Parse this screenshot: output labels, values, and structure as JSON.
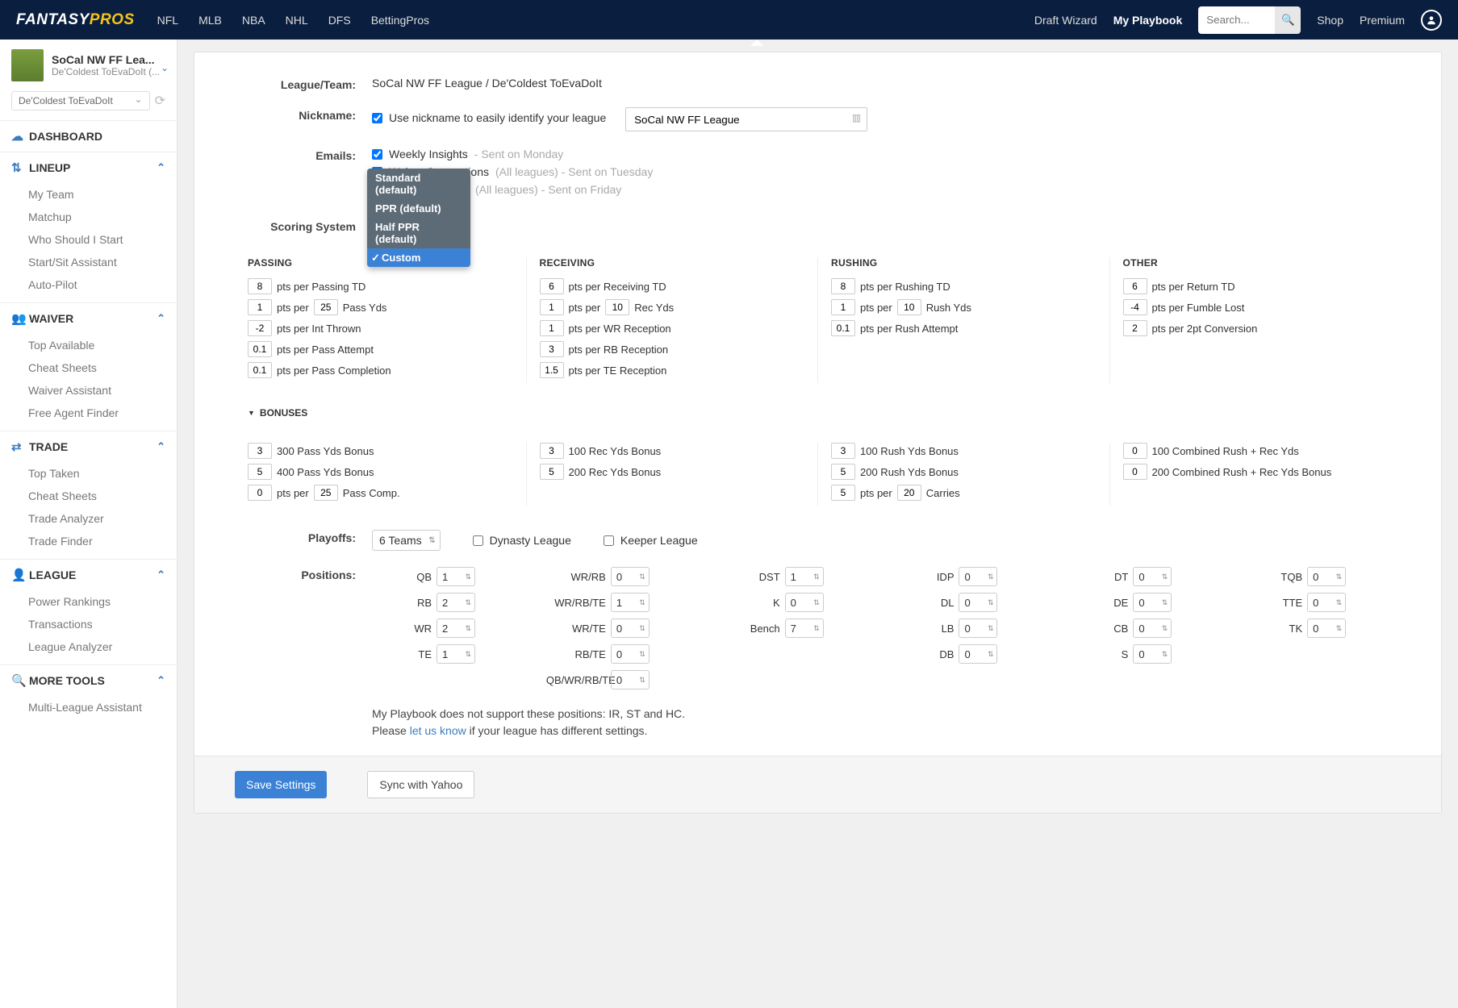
{
  "header": {
    "nav": [
      "NFL",
      "MLB",
      "NBA",
      "NHL",
      "DFS",
      "BettingPros"
    ],
    "draft_wizard": "Draft Wizard",
    "my_playbook": "My Playbook",
    "search_placeholder": "Search...",
    "shop": "Shop",
    "premium": "Premium"
  },
  "sidebar": {
    "team_name": "SoCal NW FF Lea...",
    "team_owner": "De'Coldest ToEvaDoIt (...",
    "team_select": "De'Coldest ToEvaDoIt",
    "sections": {
      "dashboard": "DASHBOARD",
      "lineup": {
        "label": "LINEUP",
        "items": [
          "My Team",
          "Matchup",
          "Who Should I Start",
          "Start/Sit Assistant",
          "Auto-Pilot"
        ]
      },
      "waiver": {
        "label": "WAIVER",
        "items": [
          "Top Available",
          "Cheat Sheets",
          "Waiver Assistant",
          "Free Agent Finder"
        ]
      },
      "trade": {
        "label": "TRADE",
        "items": [
          "Top Taken",
          "Cheat Sheets",
          "Trade Analyzer",
          "Trade Finder"
        ]
      },
      "league": {
        "label": "LEAGUE",
        "items": [
          "Power Rankings",
          "Transactions",
          "League Analyzer"
        ]
      },
      "more": {
        "label": "MORE TOOLS",
        "items": [
          "Multi-League Assistant"
        ]
      }
    }
  },
  "form": {
    "league_team_label": "League/Team:",
    "league_team_value": "SoCal NW FF League / De'Coldest ToEvaDoIt",
    "nickname_label": "Nickname:",
    "nickname_chk": "Use nickname to easily identify your league",
    "nickname_value": "SoCal NW FF League",
    "emails_label": "Emails:",
    "emails": [
      {
        "label": "Weekly Insights",
        "sub": "- Sent on Monday"
      },
      {
        "label": "Waiver Suggestions",
        "sub": "(All leagues) - Sent on Tuesday"
      },
      {
        "label": "",
        "sub": "(All leagues) - Sent on Friday"
      }
    ],
    "scoring_label": "Scoring System",
    "scoring_options": [
      "Standard (default)",
      "PPR (default)",
      "Half PPR (default)",
      "Custom"
    ],
    "playoffs_label": "Playoffs:",
    "playoffs_value": "6 Teams",
    "dynasty": "Dynasty League",
    "keeper": "Keeper League",
    "positions_label": "Positions:",
    "note1": "My Playbook does not support these positions: IR, ST and HC.",
    "note2a": "Please ",
    "note2b": "let us know",
    "note2c": " if your league has different settings.",
    "save": "Save Settings",
    "sync": "Sync with Yahoo"
  },
  "scoring": {
    "passing": {
      "title": "PASSING",
      "rows": [
        {
          "v": "8",
          "t": "pts per Passing TD"
        },
        {
          "v": "1",
          "t": "pts per",
          "v2": "25",
          "t2": "Pass Yds"
        },
        {
          "v": "-2",
          "t": "pts per Int Thrown"
        },
        {
          "v": "0.1",
          "t": "pts per Pass Attempt"
        },
        {
          "v": "0.1",
          "t": "pts per Pass Completion"
        }
      ]
    },
    "receiving": {
      "title": "RECEIVING",
      "rows": [
        {
          "v": "6",
          "t": "pts per Receiving TD"
        },
        {
          "v": "1",
          "t": "pts per",
          "v2": "10",
          "t2": "Rec Yds"
        },
        {
          "v": "1",
          "t": "pts per WR Reception"
        },
        {
          "v": "3",
          "t": "pts per RB Reception"
        },
        {
          "v": "1.5",
          "t": "pts per TE Reception"
        }
      ]
    },
    "rushing": {
      "title": "RUSHING",
      "rows": [
        {
          "v": "8",
          "t": "pts per Rushing TD"
        },
        {
          "v": "1",
          "t": "pts per",
          "v2": "10",
          "t2": "Rush Yds"
        },
        {
          "v": "0.1",
          "t": "pts per Rush Attempt"
        }
      ]
    },
    "other": {
      "title": "OTHER",
      "rows": [
        {
          "v": "6",
          "t": "pts per Return TD"
        },
        {
          "v": "-4",
          "t": "pts per Fumble Lost"
        },
        {
          "v": "2",
          "t": "pts per 2pt Conversion"
        }
      ]
    }
  },
  "bonuses_label": "BONUSES",
  "bonuses": {
    "c1": [
      {
        "v": "3",
        "t": "300 Pass Yds Bonus"
      },
      {
        "v": "5",
        "t": "400 Pass Yds Bonus"
      },
      {
        "v": "0",
        "t": "pts per",
        "v2": "25",
        "t2": "Pass Comp."
      }
    ],
    "c2": [
      {
        "v": "3",
        "t": "100 Rec Yds Bonus"
      },
      {
        "v": "5",
        "t": "200 Rec Yds Bonus"
      }
    ],
    "c3": [
      {
        "v": "3",
        "t": "100 Rush Yds Bonus"
      },
      {
        "v": "5",
        "t": "200 Rush Yds Bonus"
      },
      {
        "v": "5",
        "t": "pts per",
        "v2": "20",
        "t2": "Carries"
      }
    ],
    "c4": [
      {
        "v": "0",
        "t": "100 Combined Rush + Rec Yds"
      },
      {
        "v": "0",
        "t": "200 Combined Rush + Rec Yds Bonus"
      }
    ]
  },
  "positions": [
    {
      "l": "QB",
      "v": "1"
    },
    {
      "l": "WR/RB",
      "v": "0"
    },
    {
      "l": "DST",
      "v": "1"
    },
    {
      "l": "IDP",
      "v": "0"
    },
    {
      "l": "DT",
      "v": "0"
    },
    {
      "l": "TQB",
      "v": "0"
    },
    {
      "l": "RB",
      "v": "2"
    },
    {
      "l": "WR/RB/TE",
      "v": "1"
    },
    {
      "l": "K",
      "v": "0"
    },
    {
      "l": "DL",
      "v": "0"
    },
    {
      "l": "DE",
      "v": "0"
    },
    {
      "l": "TTE",
      "v": "0"
    },
    {
      "l": "WR",
      "v": "2"
    },
    {
      "l": "WR/TE",
      "v": "0"
    },
    {
      "l": "Bench",
      "v": "7"
    },
    {
      "l": "LB",
      "v": "0"
    },
    {
      "l": "CB",
      "v": "0"
    },
    {
      "l": "TK",
      "v": "0"
    },
    {
      "l": "TE",
      "v": "1"
    },
    {
      "l": "RB/TE",
      "v": "0"
    },
    {
      "l": "",
      "v": ""
    },
    {
      "l": "DB",
      "v": "0"
    },
    {
      "l": "S",
      "v": "0"
    },
    {
      "l": "",
      "v": ""
    },
    {
      "l": "",
      "v": ""
    },
    {
      "l": "QB/WR/RB/TE",
      "v": "0"
    }
  ]
}
